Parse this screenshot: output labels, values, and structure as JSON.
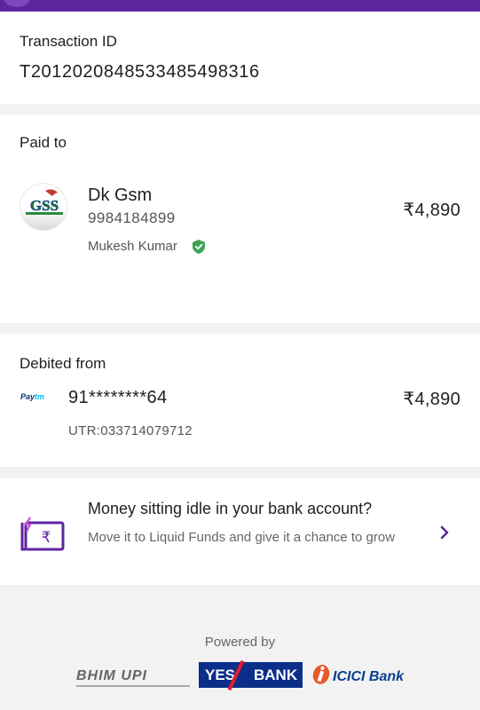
{
  "transaction": {
    "label": "Transaction ID",
    "id": "T2012020848533485498316"
  },
  "paid_to": {
    "label": "Paid to",
    "payee_name": "Dk Gsm",
    "payee_phone": "9984184899",
    "account_holder": "Mukesh Kumar",
    "amount": "₹4,890",
    "logo_text": "GSS"
  },
  "debited_from": {
    "label": "Debited from",
    "source_logo": "Paytm",
    "account_number": "91********64",
    "amount": "₹4,890",
    "utr": "UTR:033714079712"
  },
  "promo": {
    "title": "Money sitting idle in your bank account?",
    "text": "Move it to Liquid Funds and give it a chance to grow",
    "icon": "rupee-card-icon"
  },
  "footer": {
    "powered_by": "Powered by",
    "partners": {
      "bhim_upi": "BHIM UPI",
      "yes_bank_1": "YES",
      "yes_bank_2": "BANK",
      "icici": "ICICI Bank"
    }
  },
  "colors": {
    "brand": "#5f259f",
    "verified": "#3fa35a",
    "yes_bank": "#0c2e8a",
    "accent_red": "#e21b2b"
  }
}
